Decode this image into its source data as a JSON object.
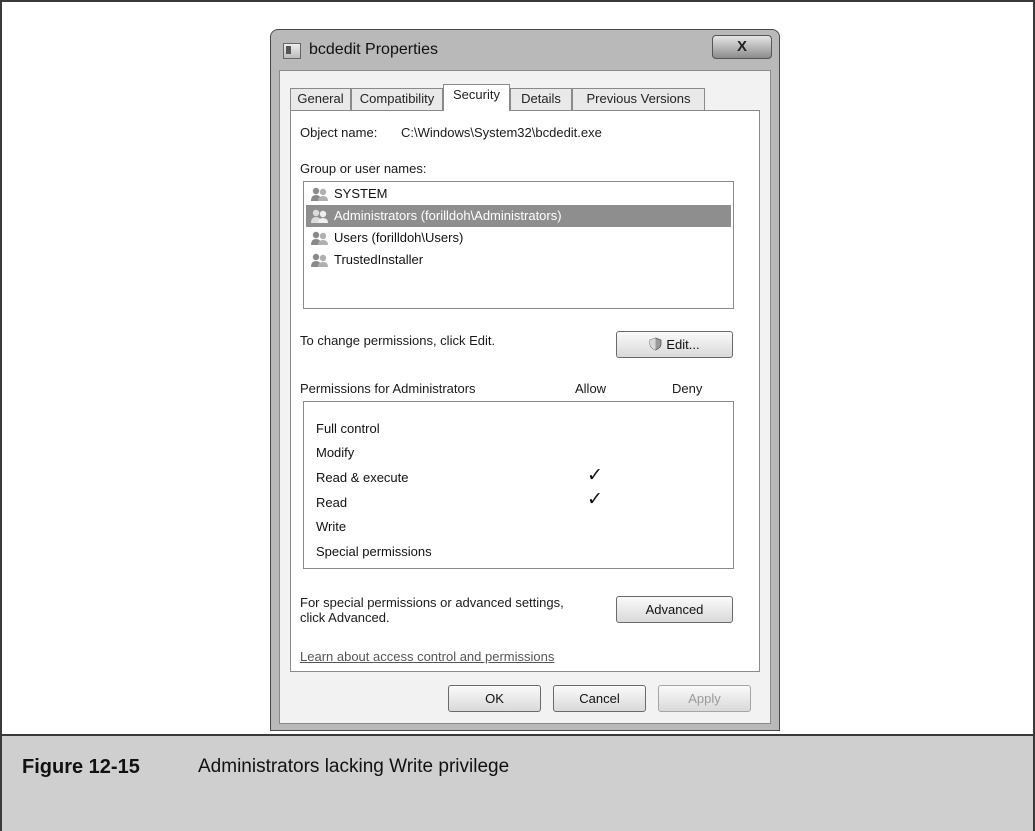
{
  "dialog": {
    "title": "bcdedit Properties",
    "close_glyph": "X",
    "tabs": [
      {
        "label": "General",
        "active": false
      },
      {
        "label": "Compatibility",
        "active": false
      },
      {
        "label": "Security",
        "active": true
      },
      {
        "label": "Details",
        "active": false
      },
      {
        "label": "Previous Versions",
        "active": false
      }
    ],
    "object_name_label": "Object name:",
    "object_name_value": "C:\\Windows\\System32\\bcdedit.exe",
    "groups_label": "Group or user names:",
    "groups": [
      {
        "label": "SYSTEM",
        "selected": false
      },
      {
        "label": "Administrators (forilldoh\\Administrators)",
        "selected": true
      },
      {
        "label": "Users (forilldoh\\Users)",
        "selected": false
      },
      {
        "label": "TrustedInstaller",
        "selected": false
      }
    ],
    "change_hint": "To change permissions, click Edit.",
    "edit_button": "Edit...",
    "permissions_label": "Permissions for Administrators",
    "allow_header": "Allow",
    "deny_header": "Deny",
    "permissions": [
      {
        "name": "Full control",
        "allow": "",
        "deny": ""
      },
      {
        "name": "Modify",
        "allow": "",
        "deny": ""
      },
      {
        "name": "Read & execute",
        "allow": "✓",
        "deny": ""
      },
      {
        "name": "Read",
        "allow": "✓",
        "deny": ""
      },
      {
        "name": "Write",
        "allow": "",
        "deny": ""
      },
      {
        "name": "Special permissions",
        "allow": "",
        "deny": ""
      }
    ],
    "advanced_hint_line1": "For special permissions or advanced settings,",
    "advanced_hint_line2": "click Advanced.",
    "advanced_button": "Advanced",
    "learn_link": "Learn about access control and permissions",
    "ok_button": "OK",
    "cancel_button": "Cancel",
    "apply_button": "Apply"
  },
  "caption": {
    "label": "Figure 12-15",
    "text": "Administrators lacking Write privilege"
  }
}
